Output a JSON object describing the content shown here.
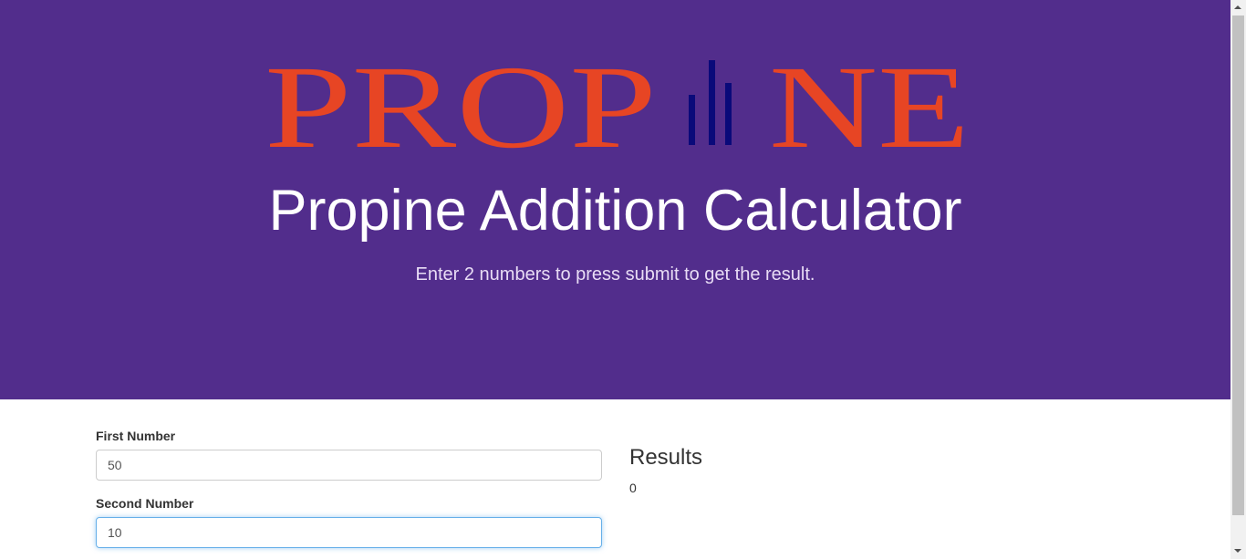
{
  "hero": {
    "logo_text_left": "PROP",
    "logo_text_right": "NE",
    "title": "Propine Addition Calculator",
    "subtitle": "Enter 2 numbers to press submit to get the result.",
    "background_color": "#522d8c",
    "logo_color": "#e74524",
    "logo_bar_color": "#0a0a7a"
  },
  "form": {
    "first_label": "First Number",
    "first_value": "50",
    "second_label": "Second Number",
    "second_value": "10"
  },
  "results": {
    "title": "Results",
    "value": "0"
  }
}
